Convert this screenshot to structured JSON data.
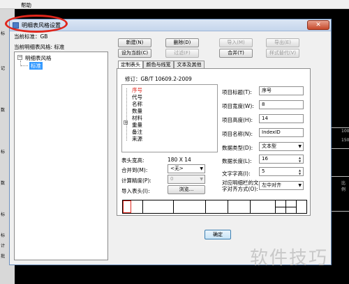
{
  "app": {
    "menu_help": "帮助",
    "left_labels": [
      "标",
      "记",
      "数",
      "标",
      "数",
      "标",
      "标",
      "计",
      "批"
    ],
    "right_texts": [
      "100",
      "150",
      "比例"
    ]
  },
  "dialog": {
    "title": "明细表风格设置",
    "close_label": "✕",
    "current_standard": "当前标准：GB",
    "current_style": "当前明细表风格: 标准",
    "tree_root": "明细表风格",
    "tree_child": "标准",
    "buttons": {
      "new": "新建(N)",
      "delete": "删除(D)",
      "import": "导入(M)",
      "export": "导出(E)",
      "set_current": "设为当前(C)",
      "filter": "过滤(F)",
      "merge": "合并(T)",
      "style_replace": "样式替代(V)",
      "ok": "确定"
    },
    "tabs": [
      "定制表头",
      "颜色与线宽",
      "文本及其他"
    ],
    "revision": "修订：GB/T 10609.2-2009",
    "struct_items": [
      {
        "label": "序号",
        "selected": true
      },
      {
        "label": "代号",
        "selected": false
      },
      {
        "label": "名称",
        "selected": false
      },
      {
        "label": "数量",
        "selected": false
      },
      {
        "label": "材料",
        "selected": false
      },
      {
        "label": "重量",
        "selected": false
      },
      {
        "label": "备注",
        "selected": false
      },
      {
        "label": "来源",
        "selected": false
      }
    ],
    "header_size_label": "表头宽高:",
    "header_size_value": "180 X 14",
    "merge_to_label": "合并到(M):",
    "merge_to_value": "<无>",
    "calc_precision_label": "计算精度(P):",
    "calc_precision_value": "0",
    "import_header_label": "导入表头(I):",
    "browse_label": "浏览...",
    "props": {
      "title_label": "项目标题(T):",
      "title_value": "序号",
      "width_label": "项目宽度(W):",
      "width_value": "8",
      "height_label": "项目高度(H):",
      "height_value": "14",
      "name_label": "项目名称(N):",
      "name_value": "IndexID",
      "type_label": "数据类型(D):",
      "type_value": "文本型",
      "length_label": "数据长度(L):",
      "length_value": "16",
      "font_label": "文字字高(I):",
      "font_value": "5",
      "align_label": "对应明细栏的文字对齐方式(O):",
      "align_value": "左中对齐"
    },
    "watermark": "软件技巧"
  }
}
